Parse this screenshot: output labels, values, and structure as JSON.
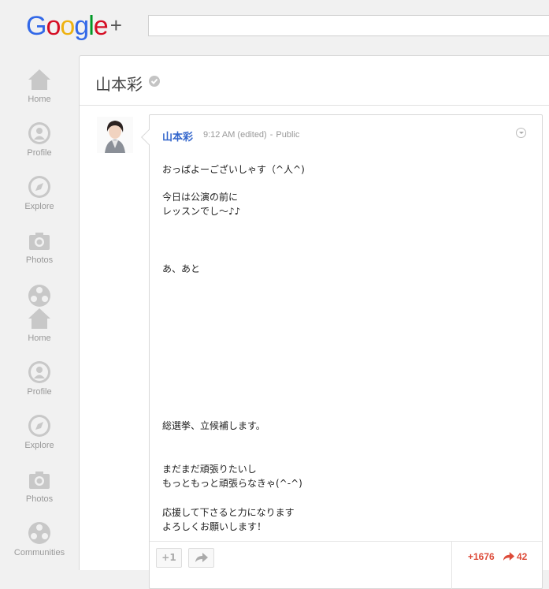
{
  "app": {
    "logo_text": "Google",
    "logo_plus": "+"
  },
  "search": {
    "placeholder": ""
  },
  "sidebar": {
    "items": [
      {
        "label": "Home",
        "icon": "home-icon"
      },
      {
        "label": "Profile",
        "icon": "profile-icon"
      },
      {
        "label": "Explore",
        "icon": "explore-icon"
      },
      {
        "label": "Photos",
        "icon": "photos-icon"
      },
      {
        "label": "Home",
        "icon": "home-icon"
      },
      {
        "label": "Profile",
        "icon": "profile-icon"
      },
      {
        "label": "Explore",
        "icon": "explore-icon"
      },
      {
        "label": "Photos",
        "icon": "photos-icon"
      },
      {
        "label": "Communities",
        "icon": "communities-icon"
      }
    ]
  },
  "page": {
    "title": "山本彩",
    "verified_icon": "verified-icon"
  },
  "post": {
    "author": "山本彩",
    "time": "9:12 AM (edited)",
    "separator": "-",
    "visibility": "Public",
    "lines": [
      "おっぱよーございしゃす（^人^)",
      "今日は公演の前に",
      "レッスンでし〜♪♪",
      "あ、あと",
      "総選挙、立候補します。",
      "まだまだ頑張りたいし",
      "もっともっと頑張らなきゃ(^-^)",
      "応援して下さると力になります",
      "よろしくお願いします！"
    ],
    "plus_one_label": "+1",
    "plus_count": "+1676",
    "reshare_count": "42"
  },
  "colors": {
    "accent_blue": "#3366cc",
    "plus_red": "#dd4b39",
    "background": "#f1f1f1"
  }
}
